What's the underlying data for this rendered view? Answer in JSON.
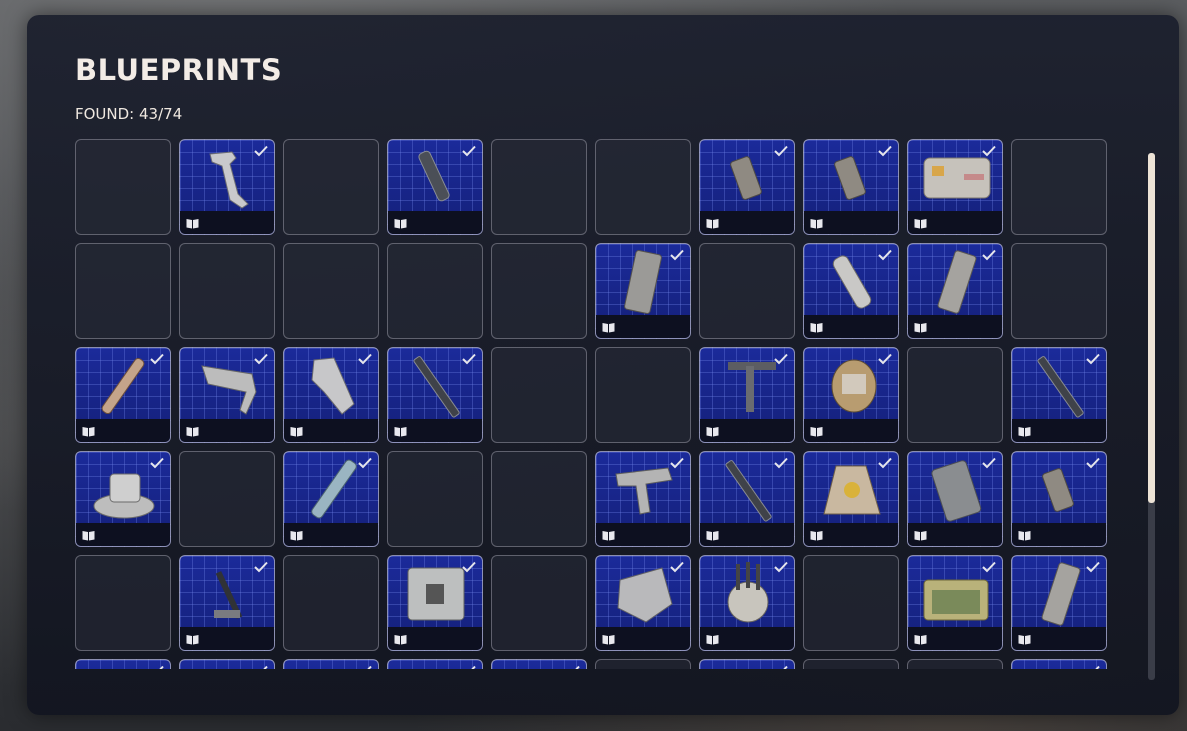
{
  "panel": {
    "title": "BLUEPRINTS",
    "found_label": "FOUND: 43/74"
  },
  "grid": {
    "columns": 10,
    "rows": [
      [
        "empty",
        "hook",
        "empty",
        "barrel",
        "empty",
        "empty",
        "muzzle",
        "muzzle",
        "case",
        "empty"
      ],
      [
        "empty",
        "empty",
        "empty",
        "empty",
        "empty",
        "magazine",
        "empty",
        "tube",
        "mag2",
        "empty"
      ],
      [
        "rocket",
        "handle",
        "stock",
        "rifle",
        "empty",
        "empty",
        "tool",
        "device",
        "empty",
        "rifle"
      ],
      [
        "turret",
        "empty",
        "syringe",
        "empty",
        "empty",
        "pistol",
        "rifle",
        "bag",
        "plate",
        "muzzle"
      ],
      [
        "empty",
        "hammer",
        "empty",
        "ammo-box",
        "empty",
        "armor",
        "drone",
        "empty",
        "briefcase",
        "mag2"
      ],
      [
        "found",
        "found",
        "found",
        "found",
        "found",
        "empty",
        "found",
        "empty",
        "empty",
        "found"
      ]
    ]
  },
  "icons": {
    "book": "blueprint-book-icon",
    "check": "checkmark-icon"
  },
  "colors": {
    "accent": "#f3ece6",
    "blueprint_bg": "#1b2a9a",
    "grid_line": "#6e82e6"
  }
}
